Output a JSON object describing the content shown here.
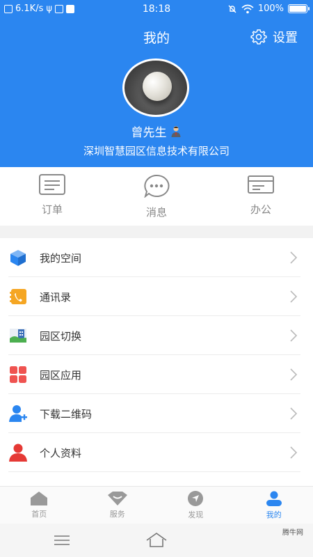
{
  "status_bar": {
    "speed": "6.1K/s",
    "time": "18:18",
    "battery": "100%"
  },
  "header": {
    "title": "我的",
    "settings_label": "设置",
    "user_name": "曾先生",
    "company": "深圳智慧园区信息技术有限公司"
  },
  "quick_actions": [
    {
      "label": "订单",
      "icon": "order-icon"
    },
    {
      "label": "消息",
      "icon": "message-icon"
    },
    {
      "label": "办公",
      "icon": "office-icon"
    }
  ],
  "menu": [
    {
      "label": "我的空间",
      "icon": "cube-icon"
    },
    {
      "label": "通讯录",
      "icon": "contacts-icon"
    },
    {
      "label": "园区切换",
      "icon": "park-switch-icon"
    },
    {
      "label": "园区应用",
      "icon": "apps-grid-icon"
    },
    {
      "label": "下载二维码",
      "icon": "add-user-icon"
    },
    {
      "label": "个人资料",
      "icon": "person-icon"
    }
  ],
  "tabs": [
    {
      "label": "首页",
      "icon": "home-icon",
      "active": false
    },
    {
      "label": "服务",
      "icon": "service-icon",
      "active": false
    },
    {
      "label": "发现",
      "icon": "compass-icon",
      "active": false
    },
    {
      "label": "我的",
      "icon": "profile-icon",
      "active": true
    }
  ],
  "watermark": "腾牛网",
  "colors": {
    "brand": "#2b86f0",
    "background": "#f2f2f2"
  }
}
